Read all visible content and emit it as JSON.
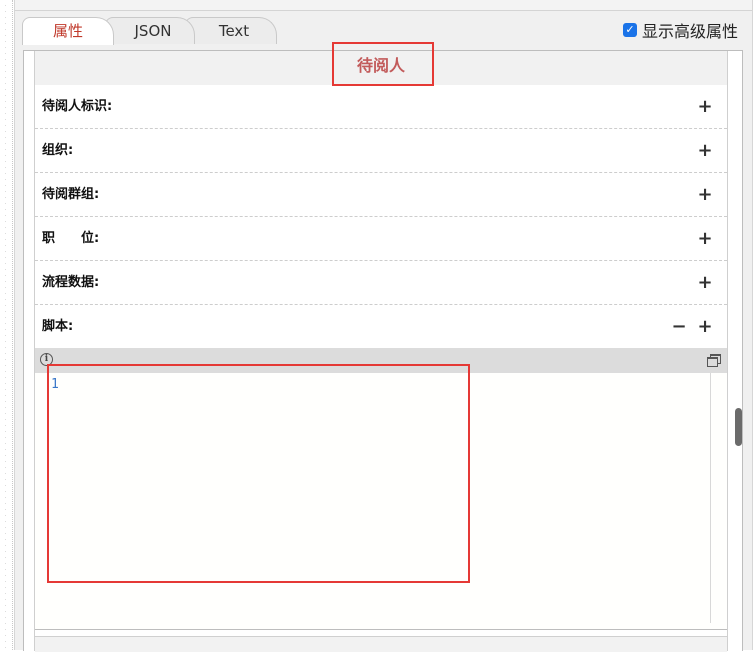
{
  "tabs": [
    {
      "label": "属性",
      "active": true
    },
    {
      "label": "JSON",
      "active": false
    },
    {
      "label": "Text",
      "active": false
    }
  ],
  "show_advanced": {
    "label": "显示高级属性",
    "checked": true
  },
  "section_title": "待阅人",
  "fields": [
    {
      "label": "待阅人标识:"
    },
    {
      "label": "组织:"
    },
    {
      "label": "待阅群组:"
    },
    {
      "label": "职　　位:"
    },
    {
      "label": "流程数据:"
    },
    {
      "label": "脚本:"
    }
  ],
  "icons": {
    "add": "+",
    "remove": "−",
    "info": "i"
  },
  "editor": {
    "line_number": "1"
  },
  "colors": {
    "active_tab": "#c0392b",
    "section_title": "#c25a5a",
    "highlight": "#e53935",
    "checkbox": "#1a73e8"
  }
}
